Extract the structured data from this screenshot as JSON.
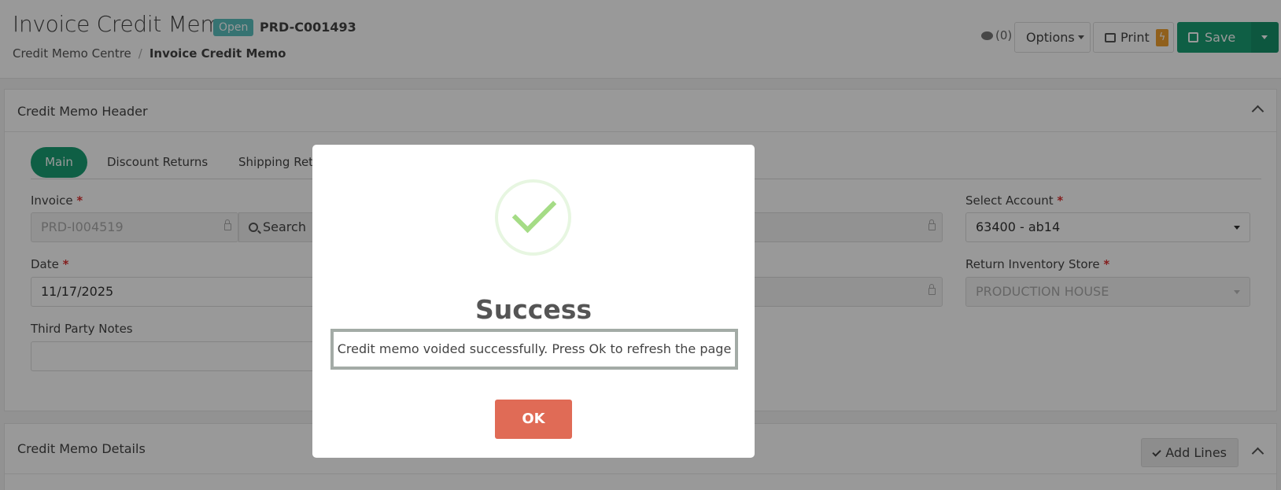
{
  "header": {
    "title": "Invoice Credit Memo",
    "status_badge": "Open",
    "doc_id": "PRD-C001493",
    "breadcrumb": [
      "Credit Memo Centre",
      "Invoice Credit Memo"
    ],
    "comments_count": "(0)",
    "options_label": "Options",
    "print_label": "Print",
    "print_badge": "ϟ",
    "save_label": "Save"
  },
  "header_panel": {
    "title": "Credit Memo Header",
    "tabs": [
      "Main",
      "Discount Returns",
      "Shipping Retur"
    ],
    "fields": {
      "invoice_label": "Invoice",
      "invoice_value": "PRD-I004519",
      "search_label": "Search",
      "date_label": "Date",
      "date_value": "11/17/2025",
      "third_party_label": "Third Party Notes",
      "select_account_label": "Select Account",
      "select_account_value": "63400 - ab14",
      "return_store_label": "Return Inventory Store",
      "return_store_value": "PRODUCTION HOUSE"
    },
    "required_mark": "*"
  },
  "details_panel": {
    "title": "Credit Memo Details",
    "add_lines_label": "Add Lines"
  },
  "modal": {
    "title": "Success",
    "message": "Credit memo voided successfully. Press Ok to refresh the page",
    "ok_label": "OK"
  },
  "colors": {
    "primary_green": "#1a9e73",
    "open_badge": "#5bc0be",
    "ok_button": "#e06b56",
    "success_check": "#a5dc86"
  }
}
